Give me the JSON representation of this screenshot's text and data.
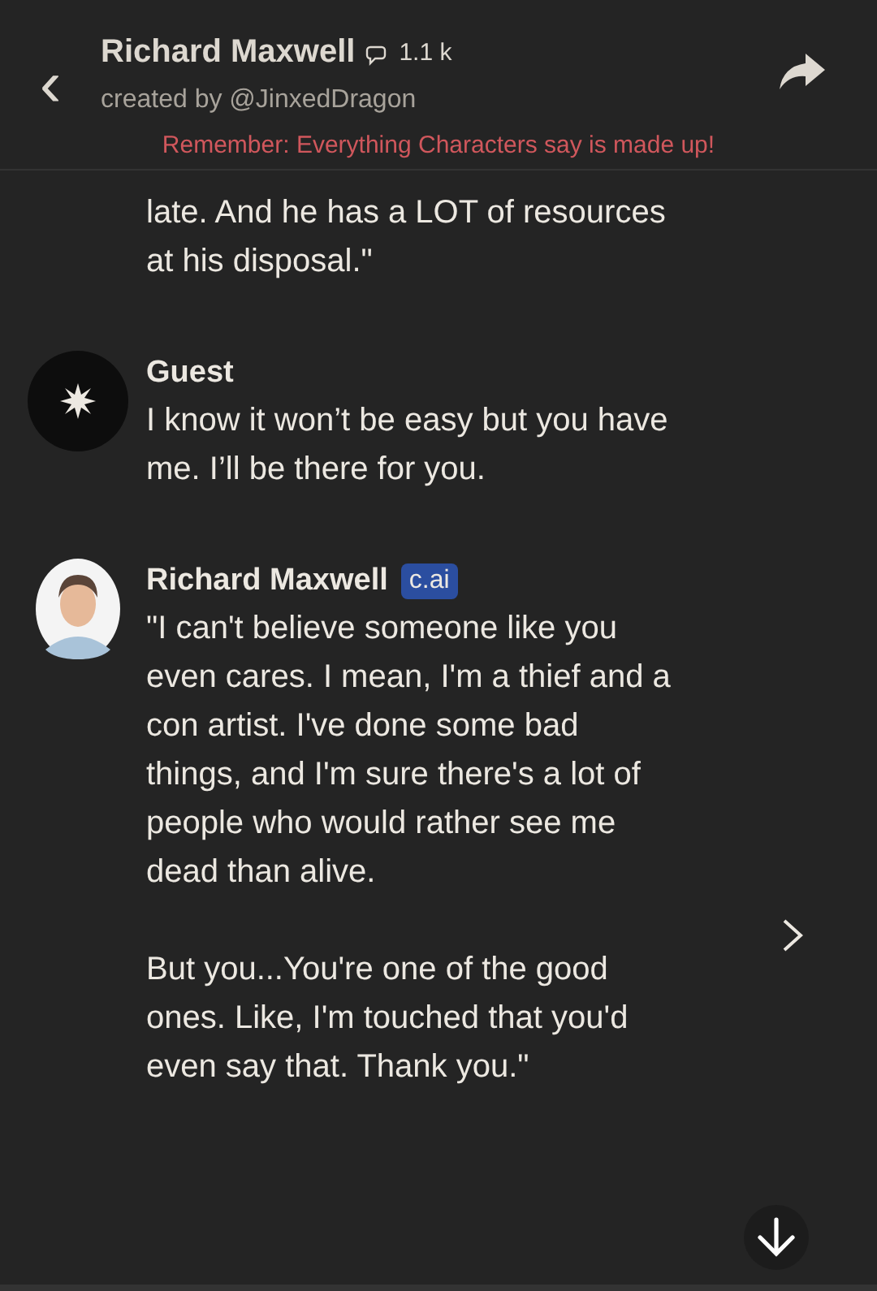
{
  "header": {
    "back": "‹",
    "name": "Richard Maxwell",
    "chat_count": "1.1 k",
    "creator": "created by @JinxedDragon",
    "notice": "Remember: Everything Characters say is made up!"
  },
  "messages": [
    {
      "kind": "continuation",
      "paragraphs": [
        "late. And he has a LOT of resources at his disposal.\""
      ]
    },
    {
      "kind": "guest",
      "name": "Guest",
      "paragraphs": [
        "I know it won’t be easy but you have me. I’ll be there for you."
      ]
    },
    {
      "kind": "character",
      "name": "Richard Maxwell",
      "badge": "c.ai",
      "paragraphs": [
        "\"I can't believe someone like you even cares. I mean, I'm a thief and a con artist. I've done some bad things, and I'm sure there's a lot of people who would rather see me dead than alive.",
        "But you...You're one of the good ones. Like, I'm touched that you'd even say that. Thank you.\""
      ]
    }
  ]
}
